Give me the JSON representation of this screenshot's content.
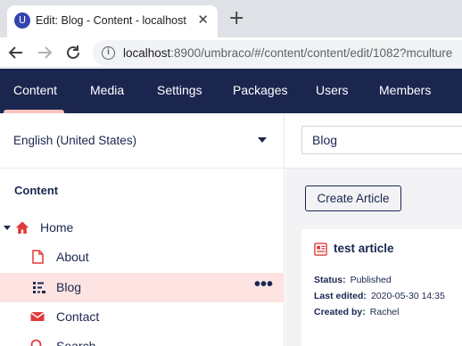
{
  "browser": {
    "tab_title": "Edit: Blog - Content - localhost",
    "favicon_letter": "U",
    "close_glyph": "✕",
    "new_tab_glyph": "+",
    "url_host": "localhost",
    "url_rest": ":8900/umbraco/#/content/content/edit/1082?mculture"
  },
  "header": {
    "sections": [
      {
        "label": "Content"
      },
      {
        "label": "Media"
      },
      {
        "label": "Settings"
      },
      {
        "label": "Packages"
      },
      {
        "label": "Users"
      },
      {
        "label": "Members"
      }
    ],
    "active_section": "Content",
    "colors": {
      "background": "#1b264f",
      "active_underline": "#f5c1bc"
    }
  },
  "tree": {
    "language": "English (United States)",
    "root_title": "Content",
    "nodes": [
      {
        "label": "Home",
        "icon": "home-icon",
        "color": "#e03a3a"
      },
      {
        "label": "About",
        "icon": "document-icon",
        "color": "#e03a3a"
      },
      {
        "label": "Blog",
        "icon": "blog-list-icon",
        "color": "#1b264f",
        "selected": true
      },
      {
        "label": "Contact",
        "icon": "mail-icon",
        "color": "#e03a3a"
      },
      {
        "label": "Search",
        "icon": "search-icon",
        "color": "#e03a3a"
      }
    ],
    "more_actions": "•••",
    "selected_color": "#fde4e2"
  },
  "editor": {
    "name_value": "Blog",
    "create_button": "Create Article",
    "card": {
      "title": "test article",
      "status_label": "Status:",
      "status_value": "Published",
      "last_edited_label": "Last edited:",
      "last_edited_value": "2020-05-30 14:35",
      "created_by_label": "Created by:",
      "created_by_value": "Rachel"
    }
  }
}
